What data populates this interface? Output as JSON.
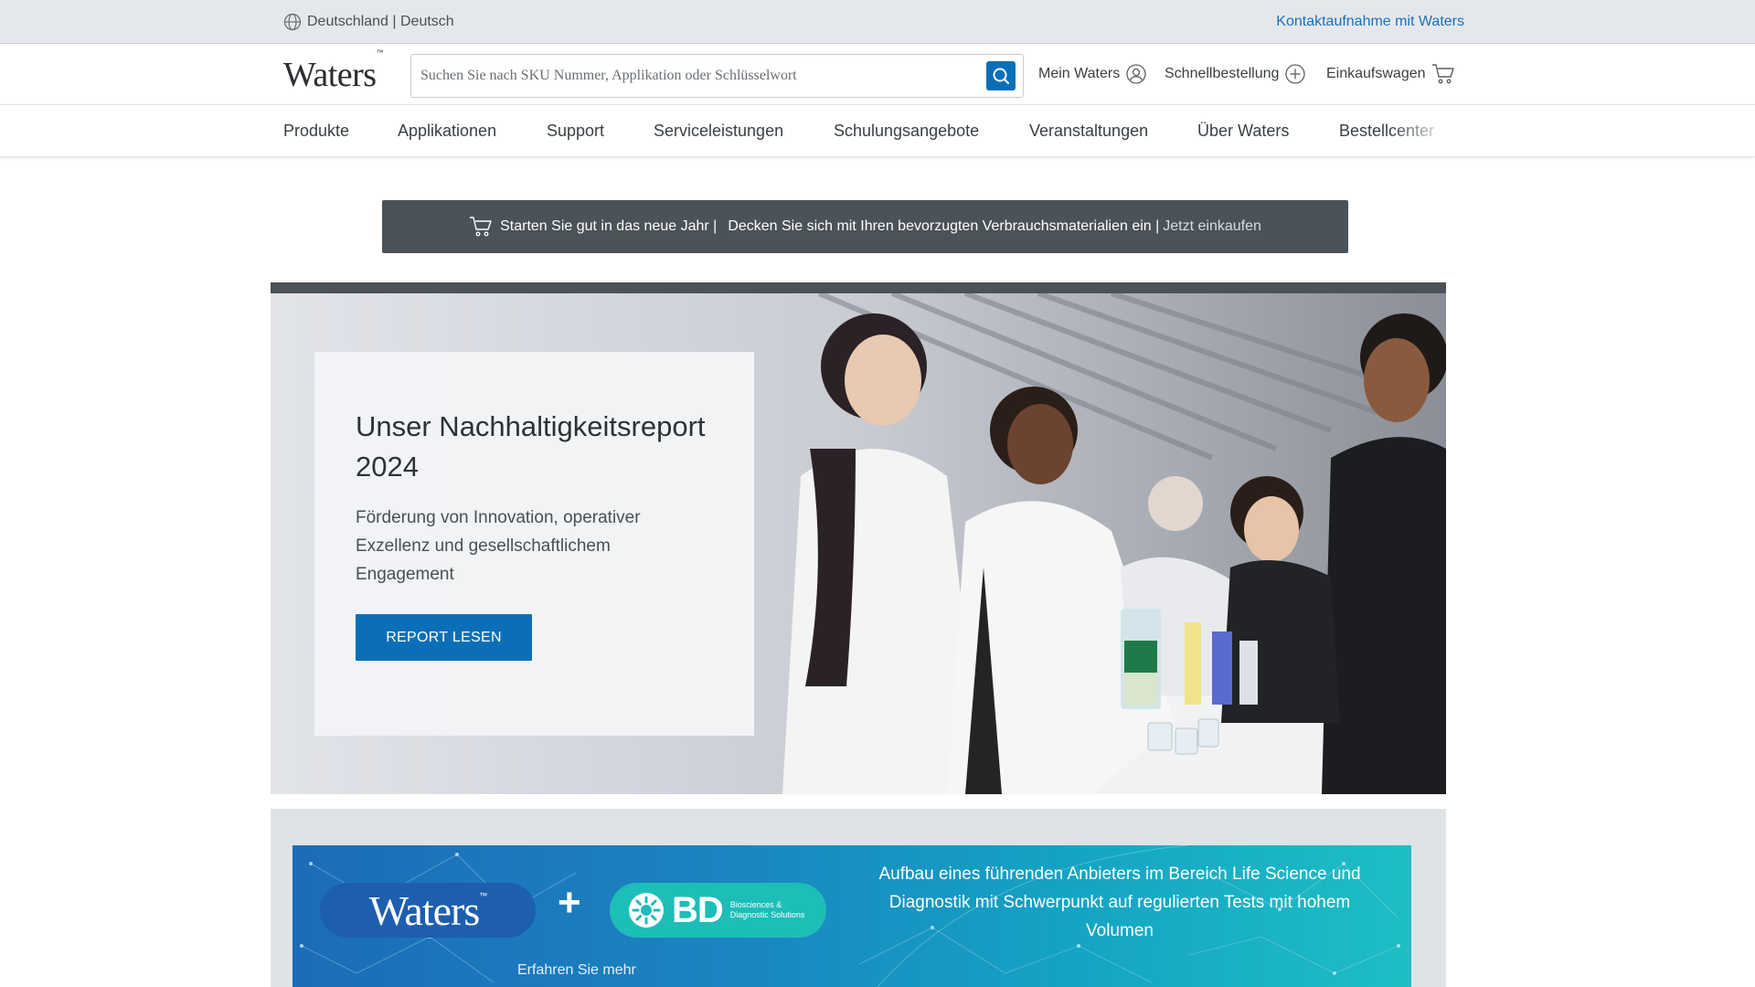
{
  "utility": {
    "locale_label": "Deutschland | Deutsch",
    "contact_label": "Kontaktaufnahme mit Waters"
  },
  "header": {
    "logo_text": "Waters",
    "logo_tm": "™",
    "search_placeholder": "Suchen Sie nach SKU Nummer, Applikation oder Schlüsselwort",
    "links": {
      "my_waters": "Mein Waters",
      "quick_order": "Schnellbestellung",
      "cart": "Einkaufswagen"
    }
  },
  "nav": {
    "items": [
      "Produkte",
      "Applikationen",
      "Support",
      "Serviceleistungen",
      "Schulungsangebote",
      "Veranstaltungen",
      "Über Waters",
      "Bestellcenter"
    ]
  },
  "promo": {
    "text_1": "Starten Sie gut in das neue Jahr |",
    "text_2": "Decken Sie sich mit Ihren bevorzugten Verbrauchsmaterialien ein |",
    "link": "Jetzt einkaufen"
  },
  "hero": {
    "title": "Unser Nachhaltigkeitsreport 2024",
    "subtitle": "Förderung von Innovation, operativer Exzellenz und gesellschaftlichem Engagement",
    "button": "REPORT LESEN"
  },
  "merger": {
    "waters_logo": "Waters",
    "waters_tm": "™",
    "plus": "+",
    "bd_logo": "BD",
    "bd_tagline": "Biosciences & Diagnostic Solutions",
    "text": "Aufbau eines führenden Anbieters im Bereich Life Science und Diagnostik mit Schwerpunkt auf regulierten Tests mit hohem Volumen",
    "link": "Erfahren Sie mehr"
  },
  "colors": {
    "accent": "#0a6fb8",
    "link": "#1d6fb8",
    "promo_bg": "#4b5258",
    "utility_bg": "#e4e8ec"
  }
}
